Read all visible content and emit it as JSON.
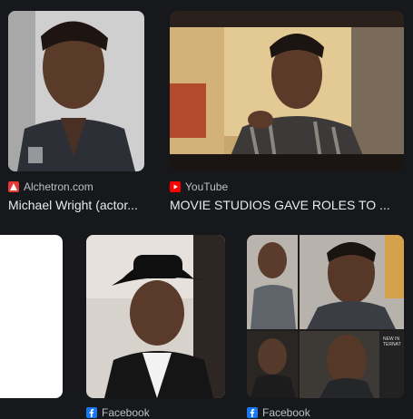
{
  "results": [
    {
      "source": "Alchetron.com",
      "source_icon": "alchetron-favicon-icon",
      "source_color": "#e53935",
      "title": "Michael Wright (actor..."
    },
    {
      "source": "YouTube",
      "source_icon": "youtube-favicon-icon",
      "source_color": "#ff0000",
      "title": "MOVIE STUDIOS GAVE ROLES TO ..."
    },
    {
      "source": "Facebook",
      "source_icon": "facebook-favicon-icon",
      "source_color": "#1877f2",
      "title": ""
    },
    {
      "source": "Facebook",
      "source_icon": "facebook-favicon-icon",
      "source_color": "#1877f2",
      "title": ""
    }
  ],
  "watermark_text": "NEW INTERNAT",
  "colors": {
    "background": "#17181c",
    "text_primary": "#e8eaed",
    "text_secondary": "#bdc1c6"
  }
}
